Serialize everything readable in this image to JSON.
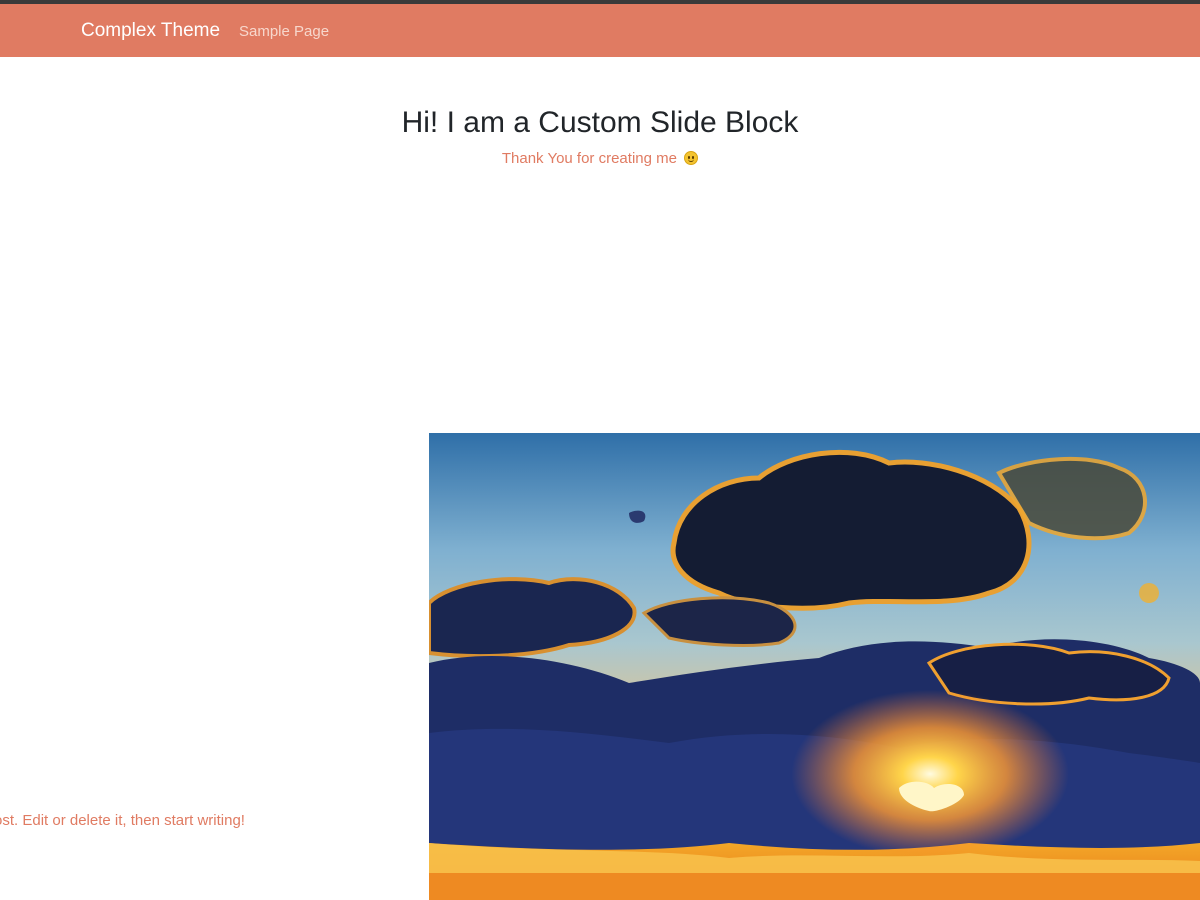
{
  "navbar": {
    "brand": "Complex Theme",
    "links": [
      {
        "label": "Sample Page"
      }
    ],
    "background_color": "#e07b62"
  },
  "slide": {
    "title": "Hi! I am a Custom Slide Block",
    "subtitle": "Thank You for creating me",
    "subtitle_icon": "slightly-smiling-face-icon"
  },
  "post": {
    "excerpt_visible": "ost. Edit or delete it, then start writing!"
  },
  "image": {
    "subject": "sunset-sky-photo"
  },
  "colors": {
    "accent": "#e07b62",
    "title_text": "#212529"
  }
}
